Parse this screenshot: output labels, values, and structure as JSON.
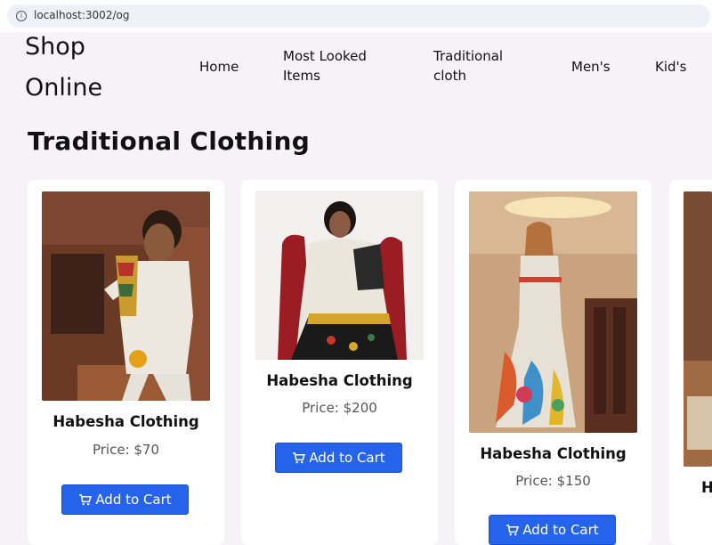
{
  "browser": {
    "url": "localhost:3002/og",
    "info_glyph": "i"
  },
  "header": {
    "logo_line1": "Shop",
    "logo_line2": "Online",
    "nav": {
      "home": "Home",
      "most_looked_1": "Most Looked",
      "most_looked_2": "Items",
      "traditional_1": "Traditional",
      "traditional_2": "cloth",
      "mens": "Men's",
      "kids": "Kid's"
    }
  },
  "page": {
    "title": "Traditional Clothing"
  },
  "products": [
    {
      "name": "Habesha Clothing",
      "price": "Price: $70",
      "button": "Add to Cart"
    },
    {
      "name": "Habesha Clothing",
      "price": "Price: $200",
      "button": "Add to Cart"
    },
    {
      "name": "Habesha Clothing",
      "price": "Price: $150",
      "button": "Add to Cart"
    },
    {
      "name": "Habesha Clothing"
    }
  ],
  "colors": {
    "accent": "#2563eb",
    "background": "#f5f3f6",
    "card": "#ffffff"
  },
  "icons": {
    "info": "info-icon",
    "cart": "cart-icon"
  }
}
